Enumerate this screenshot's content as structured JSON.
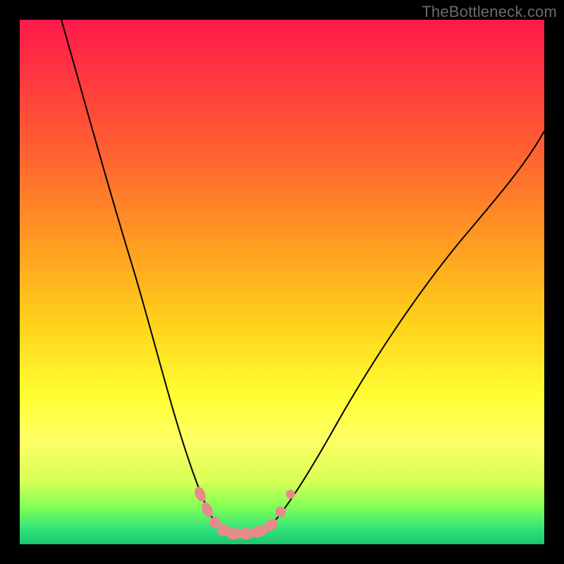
{
  "watermark": "TheBottleneck.com",
  "plot": {
    "background_gradient_stops": [
      {
        "pos": 0,
        "color": "#ff1a4b"
      },
      {
        "pos": 12,
        "color": "#ff3a3e"
      },
      {
        "pos": 28,
        "color": "#ff6a2e"
      },
      {
        "pos": 42,
        "color": "#ff9a22"
      },
      {
        "pos": 58,
        "color": "#ffd21a"
      },
      {
        "pos": 72,
        "color": "#ffff33"
      },
      {
        "pos": 80,
        "color": "#ffff66"
      },
      {
        "pos": 88,
        "color": "#d8ff55"
      },
      {
        "pos": 93,
        "color": "#7fff55"
      },
      {
        "pos": 97,
        "color": "#33e37a"
      },
      {
        "pos": 100,
        "color": "#18c76c"
      }
    ],
    "frame_color": "#000000",
    "curve_color": "#000000",
    "marker_color": "#e88a8a"
  },
  "chart_data": {
    "type": "line",
    "title": "",
    "xlabel": "",
    "ylabel": "",
    "x_range_frac": [
      0,
      1
    ],
    "y_range_frac": [
      0,
      1
    ],
    "note": "Axes are unlabeled; values given as fractional plot-area coordinates (0 = left/top edge of colored area, 1 = right/bottom). y increases downward toward green band. Two curves form a V whose trough sits on the green band.",
    "series": [
      {
        "name": "left-curve",
        "description": "steep descending curve from upper-left down to trough",
        "points": [
          {
            "x": 0.08,
            "y": 0.0
          },
          {
            "x": 0.11,
            "y": 0.1
          },
          {
            "x": 0.145,
            "y": 0.22
          },
          {
            "x": 0.18,
            "y": 0.34
          },
          {
            "x": 0.215,
            "y": 0.46
          },
          {
            "x": 0.248,
            "y": 0.58
          },
          {
            "x": 0.278,
            "y": 0.7
          },
          {
            "x": 0.305,
            "y": 0.8
          },
          {
            "x": 0.328,
            "y": 0.88
          },
          {
            "x": 0.348,
            "y": 0.93
          },
          {
            "x": 0.368,
            "y": 0.96
          },
          {
            "x": 0.39,
            "y": 0.978
          }
        ]
      },
      {
        "name": "trough",
        "description": "near-flat bottom segment of the V lying on green band",
        "points": [
          {
            "x": 0.39,
            "y": 0.978
          },
          {
            "x": 0.41,
            "y": 0.98
          },
          {
            "x": 0.43,
            "y": 0.98
          },
          {
            "x": 0.45,
            "y": 0.978
          },
          {
            "x": 0.47,
            "y": 0.972
          }
        ]
      },
      {
        "name": "right-curve",
        "description": "ascending curve from trough up toward right edge, gentler than the left side",
        "points": [
          {
            "x": 0.47,
            "y": 0.972
          },
          {
            "x": 0.5,
            "y": 0.94
          },
          {
            "x": 0.54,
            "y": 0.88
          },
          {
            "x": 0.59,
            "y": 0.79
          },
          {
            "x": 0.65,
            "y": 0.68
          },
          {
            "x": 0.72,
            "y": 0.56
          },
          {
            "x": 0.8,
            "y": 0.44
          },
          {
            "x": 0.88,
            "y": 0.34
          },
          {
            "x": 0.95,
            "y": 0.26
          },
          {
            "x": 1.0,
            "y": 0.21
          }
        ]
      }
    ],
    "markers": {
      "description": "salmon-colored circular/capsule markers clustered around the trough on both sides",
      "points_frac": [
        {
          "x": 0.345,
          "y": 0.905,
          "r": 0.012,
          "shape": "pill-angled"
        },
        {
          "x": 0.358,
          "y": 0.935,
          "r": 0.011,
          "shape": "pill-angled"
        },
        {
          "x": 0.372,
          "y": 0.958,
          "r": 0.01,
          "shape": "circle"
        },
        {
          "x": 0.388,
          "y": 0.974,
          "r": 0.011,
          "shape": "circle"
        },
        {
          "x": 0.408,
          "y": 0.98,
          "r": 0.011,
          "shape": "pill-horizontal"
        },
        {
          "x": 0.432,
          "y": 0.98,
          "r": 0.011,
          "shape": "pill-horizontal"
        },
        {
          "x": 0.456,
          "y": 0.976,
          "r": 0.011,
          "shape": "pill-horizontal"
        },
        {
          "x": 0.478,
          "y": 0.964,
          "r": 0.011,
          "shape": "pill-angled-up"
        },
        {
          "x": 0.498,
          "y": 0.938,
          "r": 0.01,
          "shape": "circle"
        },
        {
          "x": 0.516,
          "y": 0.905,
          "r": 0.009,
          "shape": "circle"
        }
      ]
    }
  }
}
